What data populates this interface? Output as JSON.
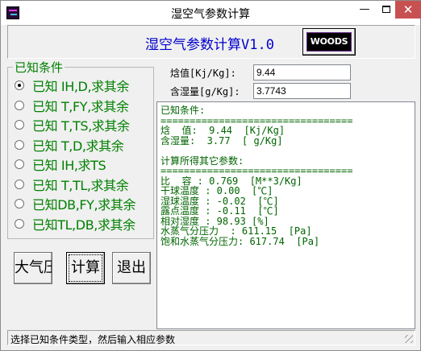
{
  "window": {
    "title": "湿空气参数计算",
    "minimize": "—",
    "close": "✕"
  },
  "header": {
    "heading": "湿空气参数计算V1.0",
    "logo_text": "WOODS"
  },
  "conditions": {
    "legend": "已知条件",
    "options": [
      {
        "label": "已知 IH,D,求其余",
        "checked": true
      },
      {
        "label": "已知 T,FY,求其余",
        "checked": false
      },
      {
        "label": "已知 T,TS,求其余",
        "checked": false
      },
      {
        "label": "已知 T,D,求其余",
        "checked": false
      },
      {
        "label": "已知 IH,求TS",
        "checked": false
      },
      {
        "label": "已知 T,TL,求其余",
        "checked": false
      },
      {
        "label": "已知DB,FY,求其余",
        "checked": false
      },
      {
        "label": "已知TL,DB,求其余",
        "checked": false
      }
    ]
  },
  "buttons": {
    "pressure": "大气压",
    "calculate": "计算",
    "exit": "退出"
  },
  "inputs": {
    "enthalpy_label": "焓值[Kj/Kg]:",
    "enthalpy_value": "9.44",
    "moisture_label": "含湿量[g/Kg]:",
    "moisture_value": "3.7743"
  },
  "output": {
    "lines": [
      "已知条件:",
      "=================================",
      "焓  值:  9.44  [Kj/Kg]",
      "含湿量:  3.77  [ g/Kg]",
      "",
      "计算所得其它参数:",
      "=================================",
      "比  容 : 0.769  [M**3/Kg]",
      "干球温度 : 0.00  [℃]",
      "湿球温度 : -0.02  [℃]",
      "露点温度 : -0.11  [℃]",
      "相对湿度 : 98.93 [%]",
      "水蒸气分压力  : 611.15  [Pa]",
      "饱和水蒸气分压力: 617.74  [Pa]"
    ]
  },
  "status": {
    "text": "选择已知条件类型，然后输入相应参数"
  }
}
